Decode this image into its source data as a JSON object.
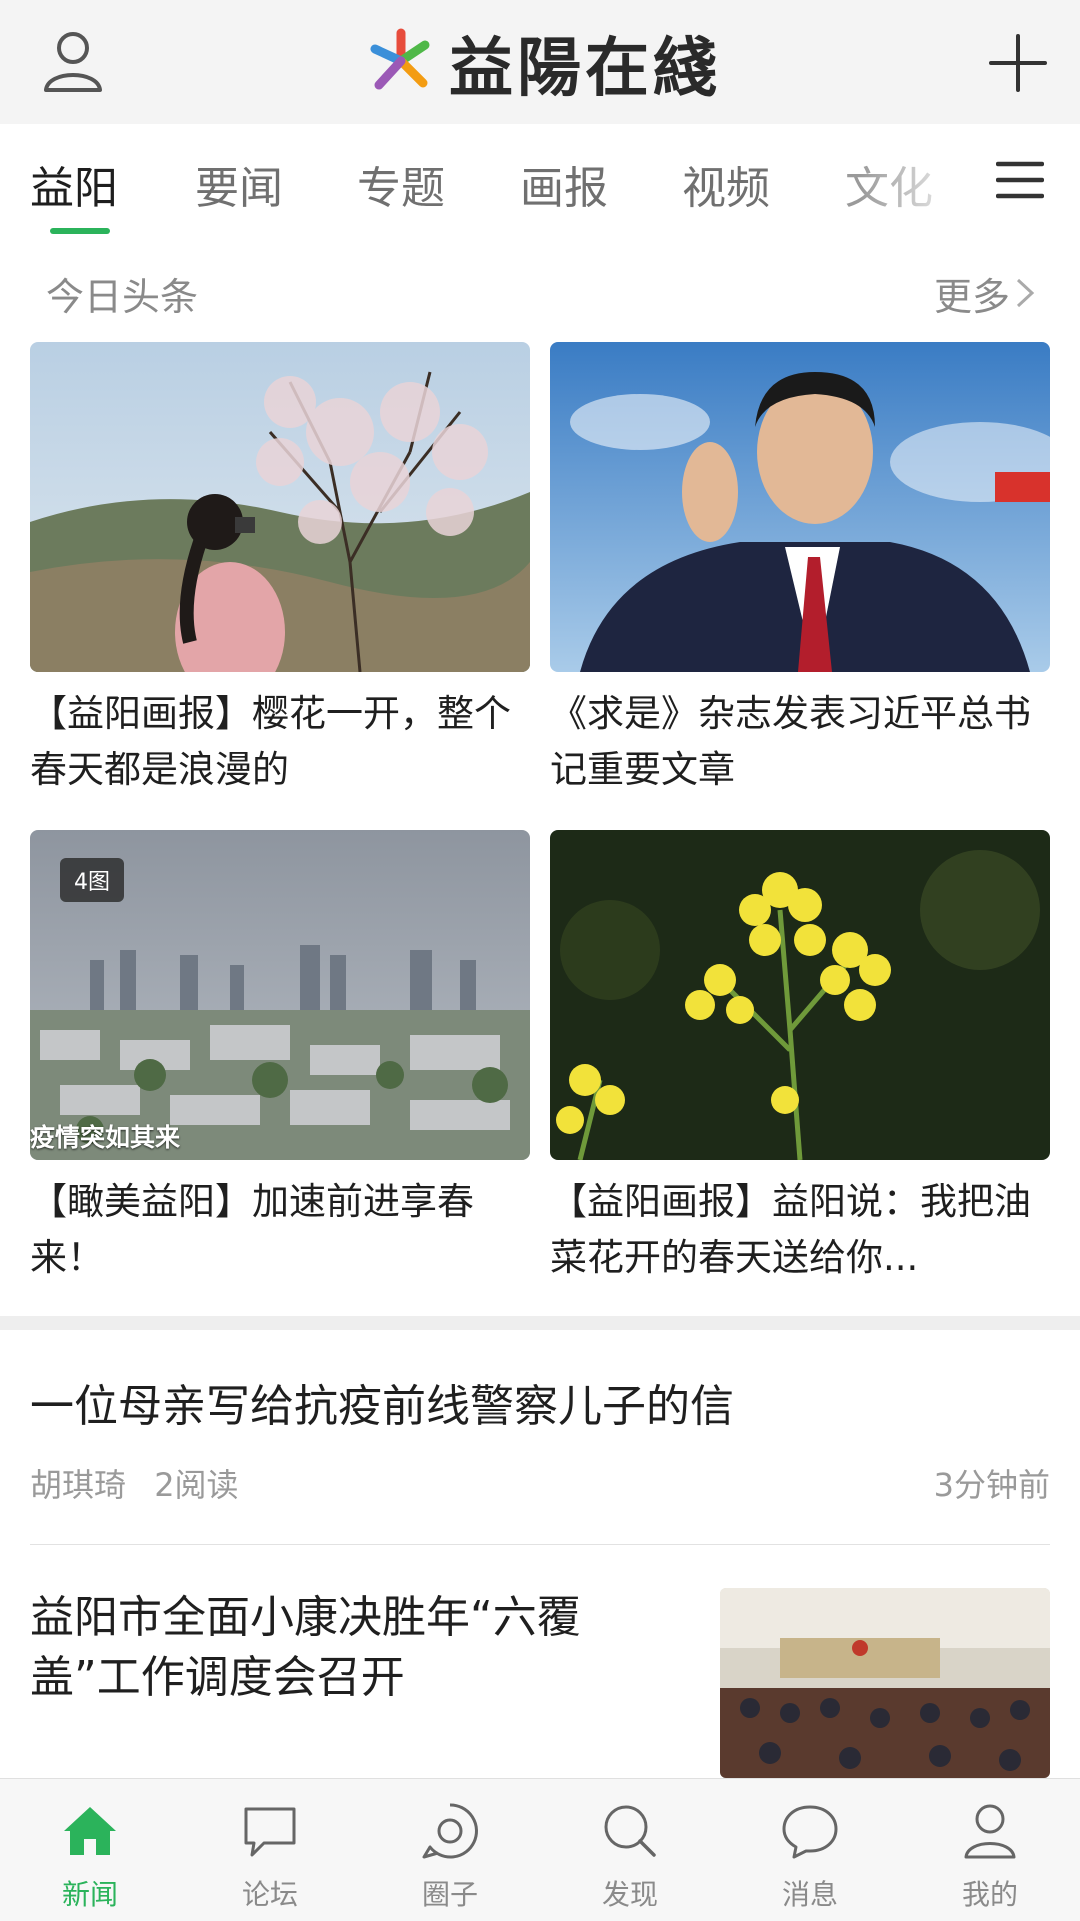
{
  "header": {
    "logo_text": "益陽在綫",
    "user_icon": "user-icon",
    "add_icon": "plus-icon"
  },
  "tabs": [
    {
      "label": "益阳",
      "active": true
    },
    {
      "label": "要闻",
      "active": false
    },
    {
      "label": "专题",
      "active": false
    },
    {
      "label": "画报",
      "active": false
    },
    {
      "label": "视频",
      "active": false
    },
    {
      "label": "文化",
      "active": false
    }
  ],
  "tabs_menu_icon": "hamburger-menu-icon",
  "section": {
    "title": "今日头条",
    "more": "更多"
  },
  "cards": [
    {
      "caption": "【益阳画报】樱花一开，整个春天都是浪漫的",
      "badge": "",
      "overlay": ""
    },
    {
      "caption": "《求是》杂志发表习近平总书记重要文章",
      "badge": "",
      "overlay": ""
    },
    {
      "caption": "【瞰美益阳】加速前进享春来！",
      "badge": "4图",
      "overlay": "疫情突如其来"
    },
    {
      "caption": "【益阳画报】益阳说：我把油菜花开的春天送给你...",
      "badge": "",
      "overlay": ""
    }
  ],
  "articles": [
    {
      "title": "一位母亲写给抗疫前线警察儿子的信",
      "author": "胡琪琦",
      "reads": "2阅读",
      "time": "3分钟前"
    },
    {
      "title": "益阳市全面小康决胜年“六覆盖”工作调度会召开"
    }
  ],
  "bottom_nav": [
    {
      "label": "新闻",
      "icon": "home-icon",
      "active": true
    },
    {
      "label": "论坛",
      "icon": "forum-icon",
      "active": false
    },
    {
      "label": "圈子",
      "icon": "circle-icon",
      "active": false
    },
    {
      "label": "发现",
      "icon": "search-icon",
      "active": false
    },
    {
      "label": "消息",
      "icon": "message-icon",
      "active": false
    },
    {
      "label": "我的",
      "icon": "profile-icon",
      "active": false
    }
  ],
  "colors": {
    "accent": "#2bb35b",
    "header_bg": "#f4f4f4",
    "nav_bg": "#f7f7f7"
  }
}
